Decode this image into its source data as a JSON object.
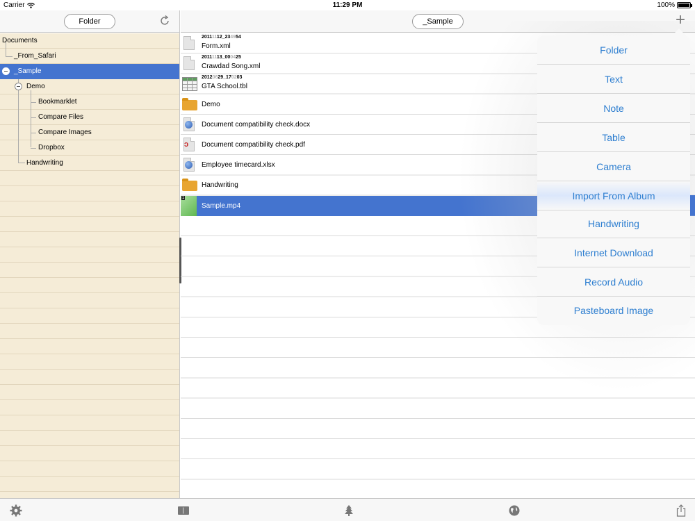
{
  "status_bar": {
    "carrier": "Carrier",
    "time": "11:29 PM",
    "battery": "100%"
  },
  "left_toolbar": {
    "folder_button": "Folder"
  },
  "right_toolbar": {
    "path_button": "_Sample"
  },
  "tree": {
    "items": [
      {
        "label": "Documents"
      },
      {
        "label": "_From_Safari"
      },
      {
        "label": "_Sample"
      },
      {
        "label": "Demo"
      },
      {
        "label": "Bookmarklet"
      },
      {
        "label": "Compare Files"
      },
      {
        "label": "Compare Images"
      },
      {
        "label": "Dropbox"
      },
      {
        "label": "Handwriting"
      }
    ]
  },
  "files": [
    {
      "sub": [
        "2011",
        "11",
        "12_23",
        "49",
        "54"
      ],
      "name": "Form.xml",
      "icon": "xml-file-icon"
    },
    {
      "sub": [
        "2011",
        "11",
        "13_00",
        "04",
        "25"
      ],
      "name": "Crawdad Song.xml",
      "icon": "xml-file-icon"
    },
    {
      "sub": [
        "2012",
        "06",
        "29_17",
        "02",
        "03"
      ],
      "name": "GTA School.tbl",
      "icon": "table-file-icon"
    },
    {
      "name": "Demo",
      "icon": "folder-icon"
    },
    {
      "name": "Document compatibility check.docx",
      "icon": "docx-file-icon"
    },
    {
      "name": "Document compatibility check.pdf",
      "icon": "pdf-file-icon"
    },
    {
      "name": "Employee timecard.xlsx",
      "icon": "xlsx-file-icon"
    },
    {
      "name": "Handwriting",
      "icon": "folder-icon"
    },
    {
      "name": "Sample.mp4",
      "icon": "video-thumbnail-icon"
    }
  ],
  "new_menu": {
    "items": [
      {
        "label": "Folder"
      },
      {
        "label": "Text"
      },
      {
        "label": "Note"
      },
      {
        "label": "Table"
      },
      {
        "label": "Camera"
      },
      {
        "label": "Import From Album"
      },
      {
        "label": "Handwriting"
      },
      {
        "label": "Internet Download"
      },
      {
        "label": "Record Audio"
      },
      {
        "label": "Pasteboard Image"
      }
    ]
  },
  "colors": {
    "selection": "#4474cf",
    "menu_text": "#2d7ed0",
    "tree_background": "#f5ecd7"
  },
  "bottom_bar": {
    "icons": [
      "gear-icon",
      "sidebar-toggle-icon",
      "tree-icon",
      "globe-icon",
      "share-icon"
    ]
  }
}
